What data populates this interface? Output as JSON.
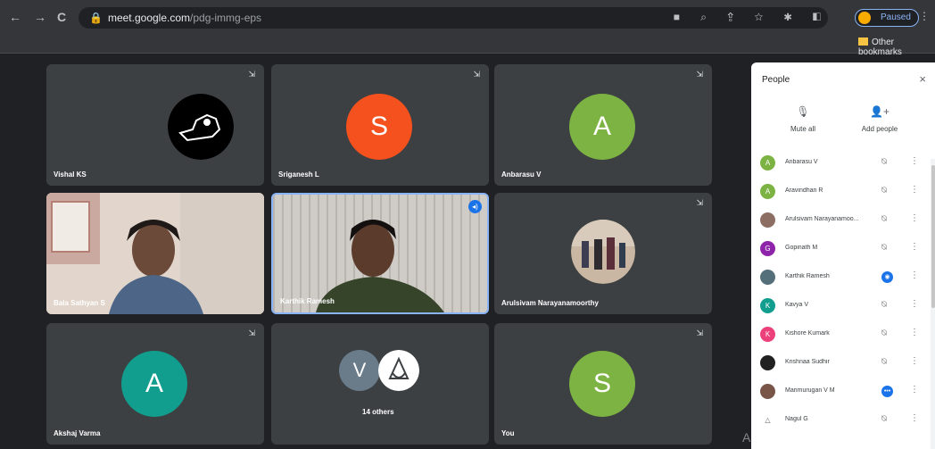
{
  "browser": {
    "back": "←",
    "forward": "→",
    "reload": "C",
    "url_domain": "meet.google.com",
    "url_path": "/pdg-immg-eps",
    "omnibox_icons": "■ ⌕ ⇪ ☆ ✱ ◧",
    "profile_label": "Paused",
    "menu": "⋮",
    "bookmark_label": "Other bookmarks"
  },
  "tiles": [
    {
      "name": "Vishal KS",
      "pin": "⇲",
      "avatar_kind": "logo"
    },
    {
      "name": "Sriganesh L",
      "pin": "⇲",
      "initial": "S",
      "color": "#f4511e"
    },
    {
      "name": "Anbarasu V",
      "pin": "⇲",
      "initial": "A",
      "color": "#7cb342"
    },
    {
      "name": "Bala Sathyan S",
      "pin": "⇲",
      "avatar_kind": "video"
    },
    {
      "name": "Karthik Ramesh",
      "pin": "⇲",
      "avatar_kind": "video",
      "speaking": true
    },
    {
      "name": "Arulsivam Narayanamoorthy",
      "pin": "⇲",
      "avatar_kind": "photo"
    },
    {
      "name": "Akshaj Varma",
      "pin": "⇲",
      "initial": "A",
      "color": "#129e8e"
    },
    {
      "name": "14 others",
      "pin": "⇲",
      "initial": "V",
      "color": "#6a7b8a"
    },
    {
      "name": "You",
      "pin": "⇲",
      "initial": "S",
      "color": "#7cb342"
    }
  ],
  "people_panel": {
    "title": "People",
    "close": "×",
    "mute_all_label": "Mute all",
    "add_people_label": "Add people",
    "participants": [
      {
        "name": "Anbarasu V",
        "initial": "A",
        "color": "#7cb342",
        "mic": "muted"
      },
      {
        "name": "Aravindhan R",
        "initial": "A",
        "color": "#7cb342",
        "mic": "muted"
      },
      {
        "name": "Arulsivam Narayanamoo...",
        "initial": "",
        "color": "#8d6e63",
        "mic": "muted"
      },
      {
        "name": "Gopinath M",
        "initial": "G",
        "color": "#8e24aa",
        "mic": "muted"
      },
      {
        "name": "Karthik Ramesh",
        "initial": "",
        "color": "#546e7a",
        "mic": "speaking"
      },
      {
        "name": "Kavya V",
        "initial": "K",
        "color": "#129e8e",
        "mic": "muted"
      },
      {
        "name": "Kishore Kumark",
        "initial": "K",
        "color": "#ec407a",
        "mic": "muted"
      },
      {
        "name": "Krishnaa Sudhir",
        "initial": "",
        "color": "#212121",
        "mic": "muted"
      },
      {
        "name": "Marimurugan V M",
        "initial": "",
        "color": "#795548",
        "mic": "active"
      },
      {
        "name": "Nagul G",
        "initial": "△",
        "color": "#ffffff",
        "mic": "muted"
      }
    ]
  },
  "watermark": "Activate Windows"
}
